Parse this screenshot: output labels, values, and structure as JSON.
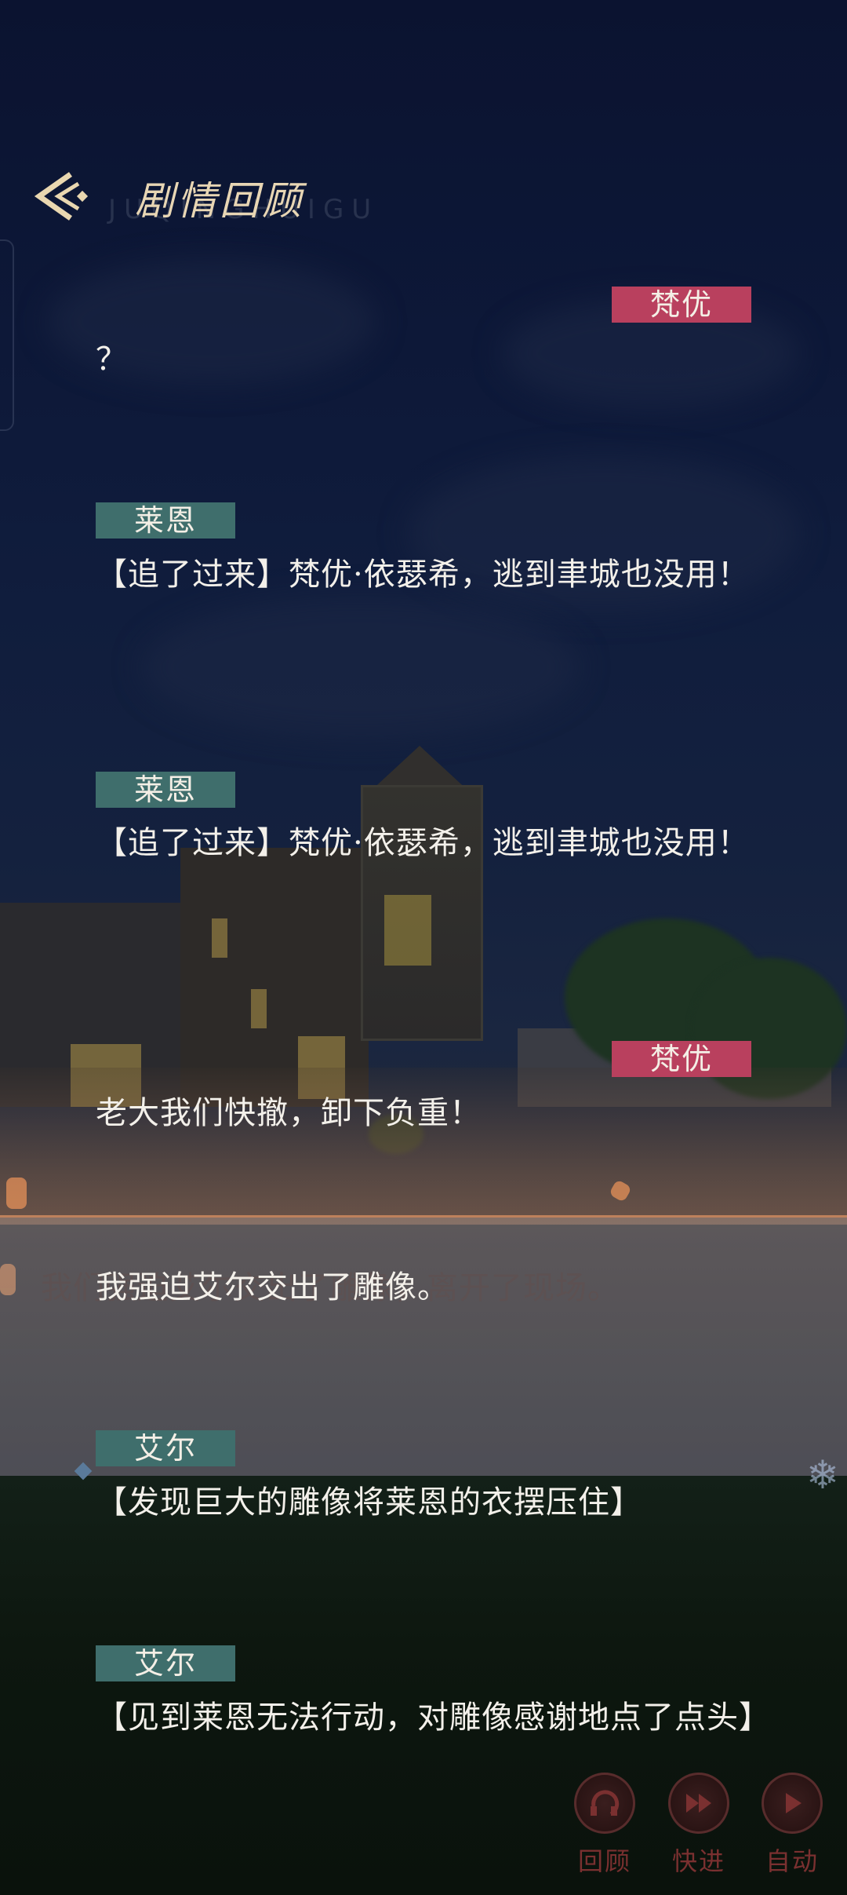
{
  "header": {
    "title": "剧情回顾",
    "subtitle": "JUQINGHUIGU"
  },
  "background": {
    "panel_text": "我们强迫艾尔交出了雕像，离开了现场。"
  },
  "entries": [
    {
      "speaker": "梵优",
      "side": "right",
      "text": "？"
    },
    {
      "speaker": "莱恩",
      "side": "left",
      "text": "【追了过来】梵优·依瑟希，逃到聿城也没用！"
    },
    {
      "speaker": "莱恩",
      "side": "left",
      "text": "【追了过来】梵优·依瑟希，逃到聿城也没用！"
    },
    {
      "speaker": "梵优",
      "side": "right",
      "text": "老大我们快撤，卸下负重！"
    },
    {
      "speaker": "",
      "side": "none",
      "text": "我强迫艾尔交出了雕像。"
    },
    {
      "speaker": "艾尔",
      "side": "left",
      "text": "【发现巨大的雕像将莱恩的衣摆压住】"
    },
    {
      "speaker": "艾尔",
      "side": "left",
      "text": "【见到莱恩无法行动，对雕像感谢地点了点头】"
    }
  ],
  "controls": {
    "review": "回顾",
    "fast_forward": "快进",
    "auto": "自动"
  },
  "colors": {
    "tag_right": "#b9405e",
    "tag_left": "#3f6e6c",
    "title": "#e8d6b4",
    "control_label": "#7a3030"
  }
}
